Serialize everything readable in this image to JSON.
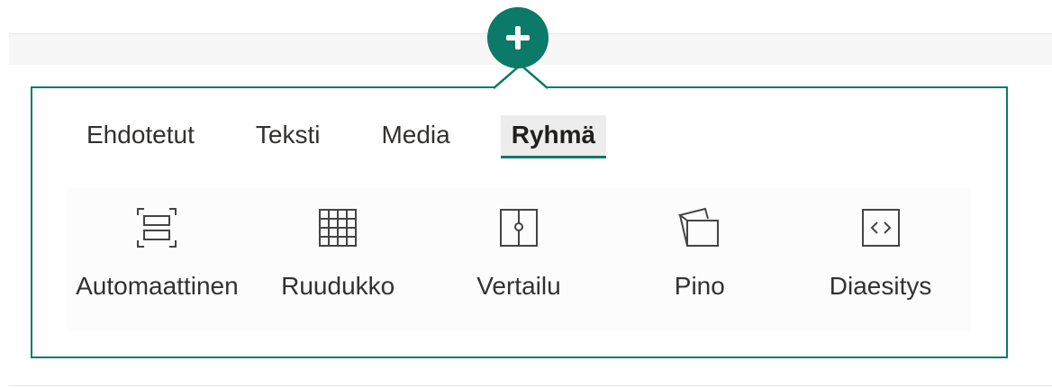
{
  "colors": {
    "accent": "#0b7a68",
    "text": "#323130",
    "active_tab_bg": "#ededed"
  },
  "add_button": {
    "icon": "plus-icon"
  },
  "tabs": [
    {
      "label": "Ehdotetut",
      "active": false
    },
    {
      "label": "Teksti",
      "active": false
    },
    {
      "label": "Media",
      "active": false
    },
    {
      "label": "Ryhmä",
      "active": true
    }
  ],
  "layouts": [
    {
      "label": "Automaattinen",
      "icon": "auto-layout-icon"
    },
    {
      "label": "Ruudukko",
      "icon": "grid-icon"
    },
    {
      "label": "Vertailu",
      "icon": "compare-icon"
    },
    {
      "label": "Pino",
      "icon": "stack-icon"
    },
    {
      "label": "Diaesitys",
      "icon": "slideshow-icon"
    }
  ]
}
